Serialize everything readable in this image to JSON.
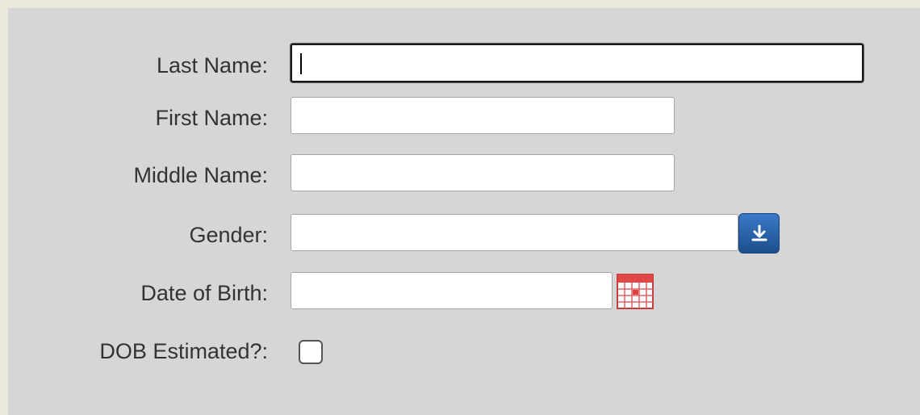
{
  "form": {
    "last_name": {
      "label": "Last Name:",
      "value": ""
    },
    "first_name": {
      "label": "First Name:",
      "value": ""
    },
    "middle_name": {
      "label": "Middle Name:",
      "value": ""
    },
    "gender": {
      "label": "Gender:",
      "value": ""
    },
    "dob": {
      "label": "Date of Birth:",
      "value": ""
    },
    "dob_estimated": {
      "label": "DOB Estimated?:",
      "checked": false
    }
  },
  "icons": {
    "gender_dropdown": "download-arrow-icon",
    "dob_picker": "calendar-icon"
  },
  "colors": {
    "dropdown_button": "#2a64ad",
    "calendar_accent": "#e04040"
  }
}
